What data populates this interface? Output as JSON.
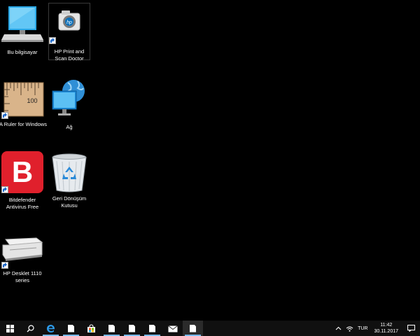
{
  "desktop": {
    "icons": [
      {
        "label": "Bu bilgisayar",
        "icon": "computer-icon"
      },
      {
        "label": "HP Print and Scan Doctor",
        "icon": "hp-camera-icon"
      },
      {
        "label": "A Ruler for Windows",
        "icon": "ruler-icon"
      },
      {
        "label": "Ağ",
        "icon": "network-globe-icon"
      },
      {
        "label": "Bitdefender Antivirus Free",
        "icon": "bitdefender-icon"
      },
      {
        "label": "Geri Dönüşüm Kutusu",
        "icon": "recycle-bin-icon"
      },
      {
        "label": "HP Desklet 1110 series",
        "icon": "printer-icon"
      }
    ],
    "ruler_mark": "100",
    "bitdefender_letter": "B",
    "hp_logo": "hp"
  },
  "taskbar": {
    "buttons": [
      {
        "icon": "windows-start-icon"
      },
      {
        "icon": "search-icon"
      },
      {
        "icon": "edge-browser-icon"
      },
      {
        "icon": "document-icon"
      },
      {
        "icon": "store-icon"
      },
      {
        "icon": "document-icon"
      },
      {
        "icon": "document-icon"
      },
      {
        "icon": "document-icon"
      },
      {
        "icon": "mail-icon"
      },
      {
        "icon": "document-icon"
      }
    ],
    "tray": {
      "language": "TUR",
      "time": "11:42",
      "date": "30.11.2017"
    }
  },
  "colors": {
    "accent": "#76b9ed",
    "bitdefender_red": "#e0202c"
  }
}
